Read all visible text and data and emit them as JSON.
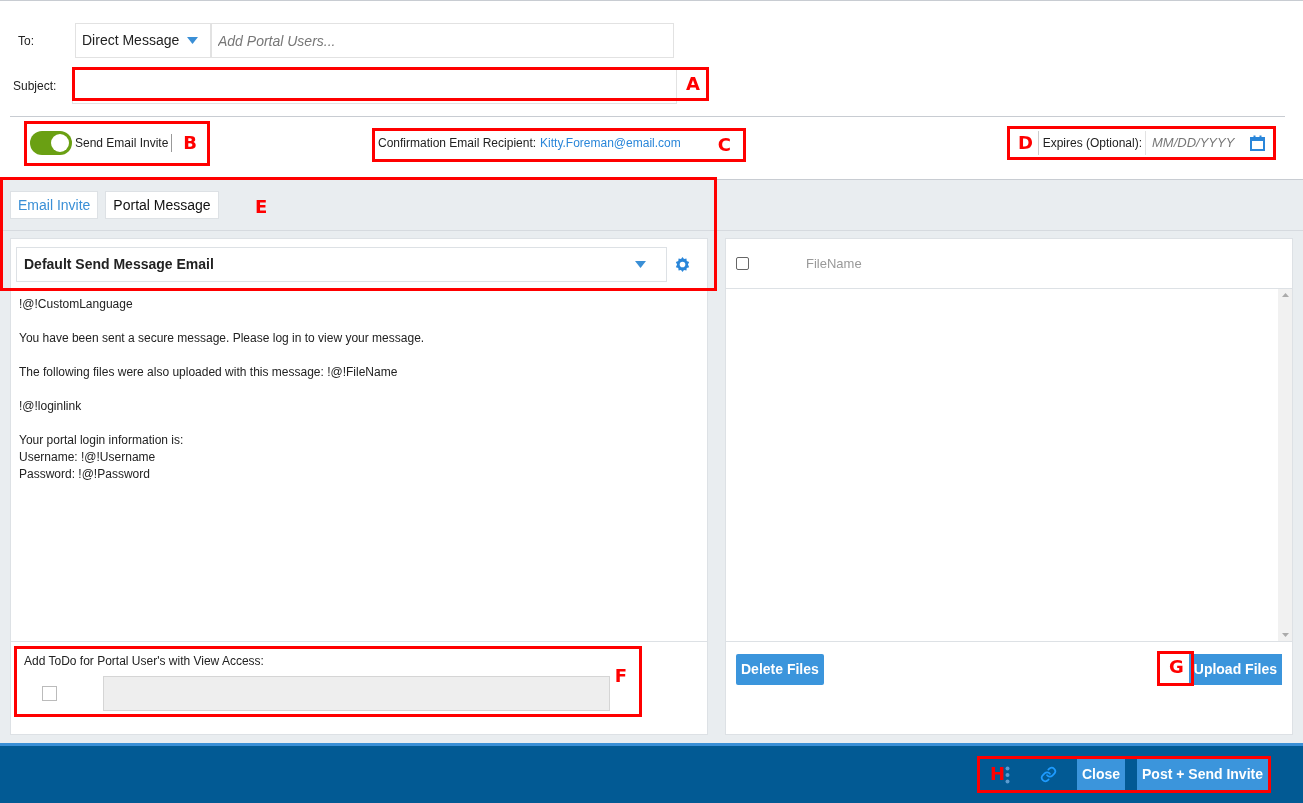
{
  "to": {
    "label": "To:",
    "type_value": "Direct Message",
    "placeholder": "Add Portal Users..."
  },
  "subject": {
    "label": "Subject:"
  },
  "send_email_invite": {
    "label": "Send Email Invite",
    "on": true
  },
  "confirmation": {
    "label": "Confirmation Email Recipient:",
    "email": "Kitty.Foreman@email.com"
  },
  "expires": {
    "label": "Expires (Optional):",
    "placeholder": "MM/DD/YYYY"
  },
  "tabs": [
    {
      "label": "Email Invite",
      "selected": true
    },
    {
      "label": "Portal Message",
      "selected": false
    }
  ],
  "template": {
    "value": "Default Send Message Email"
  },
  "message_paragraphs": [
    [
      "!@!CustomLanguage"
    ],
    [
      "You have been sent a secure message. Please log in to view your message."
    ],
    [
      "The following files were also uploaded with this message: !@!FileName"
    ],
    [
      "!@!loginlink"
    ],
    [
      "Your portal login information is:",
      "Username: !@!Username",
      "Password: !@!Password"
    ]
  ],
  "todo": {
    "label": "Add ToDo for Portal User's with View Access:",
    "checked": false
  },
  "files": {
    "select_all_checked": false,
    "column": "FileName",
    "delete_button": "Delete Files",
    "upload_button": "Upload Files"
  },
  "footer": {
    "buttons": [
      "Close",
      "Post + Send Invite"
    ]
  },
  "annotations": {
    "subject": "A",
    "toggle": "B",
    "confirmation": "C",
    "expires": "D",
    "tabs": "E",
    "todo": "F",
    "upload": "G",
    "footer": "H"
  }
}
